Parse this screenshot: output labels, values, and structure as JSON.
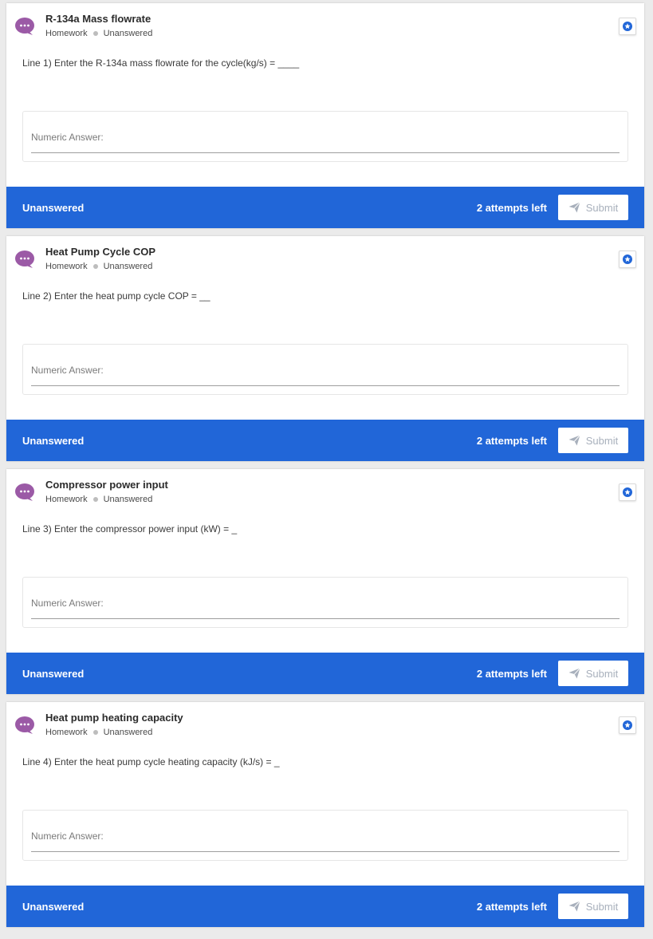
{
  "colors": {
    "accent": "#2166d8",
    "chat_icon": "#9b5aa6",
    "submit_text": "#a8b0bc"
  },
  "icons": {
    "question": "chat-bubble-icon",
    "bookmark": "star-icon",
    "submit": "send-icon"
  },
  "questions": [
    {
      "title": "R-134a Mass flowrate",
      "category": "Homework",
      "meta_status": "Unanswered",
      "prompt": "Line 1) Enter the R-134a mass flowrate for the cycle(kg/s) = ____",
      "answer_label": "Numeric Answer:",
      "status": "Unanswered",
      "attempts": "2 attempts left",
      "submit_label": "Submit"
    },
    {
      "title": "Heat Pump Cycle COP",
      "category": "Homework",
      "meta_status": "Unanswered",
      "prompt": "Line 2) Enter the heat pump cycle COP = __",
      "answer_label": "Numeric Answer:",
      "status": "Unanswered",
      "attempts": "2 attempts left",
      "submit_label": "Submit"
    },
    {
      "title": "Compressor power input",
      "category": "Homework",
      "meta_status": "Unanswered",
      "prompt": "Line 3) Enter the compressor power input (kW) = _",
      "answer_label": "Numeric Answer:",
      "status": "Unanswered",
      "attempts": "2 attempts left",
      "submit_label": "Submit"
    },
    {
      "title": "Heat pump heating capacity",
      "category": "Homework",
      "meta_status": "Unanswered",
      "prompt": "Line 4) Enter the heat pump cycle heating capacity (kJ/s) = _",
      "answer_label": "Numeric Answer:",
      "status": "Unanswered",
      "attempts": "2 attempts left",
      "submit_label": "Submit"
    }
  ]
}
